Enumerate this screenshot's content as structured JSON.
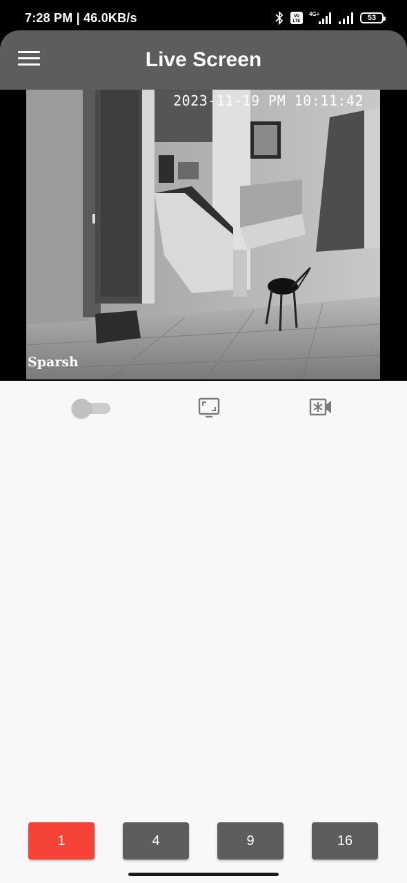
{
  "status_bar": {
    "time_speed": "7:28 PM | 46.0KB/s",
    "volte": "Vo LTE",
    "network": "4G+",
    "battery": "53"
  },
  "app_bar": {
    "title": "Live Screen",
    "menu_icon": "hamburger-menu-icon"
  },
  "camera": {
    "timestamp": "2023-11-19 PM 10:11:42",
    "name": "Sparsh"
  },
  "controls": {
    "toggle_on": false,
    "fullscreen_icon": "fullscreen-icon",
    "record_icon": "video-camera-icon"
  },
  "grid_options": {
    "items": [
      {
        "label": "1",
        "active": true
      },
      {
        "label": "4",
        "active": false
      },
      {
        "label": "9",
        "active": false
      },
      {
        "label": "16",
        "active": false
      }
    ],
    "active_color": "#f44336",
    "inactive_color": "#5d5d5d"
  },
  "colors": {
    "app_bar": "#5d5d5d",
    "background": "#f8f8f8",
    "icon_gray": "#7a7a7a"
  }
}
